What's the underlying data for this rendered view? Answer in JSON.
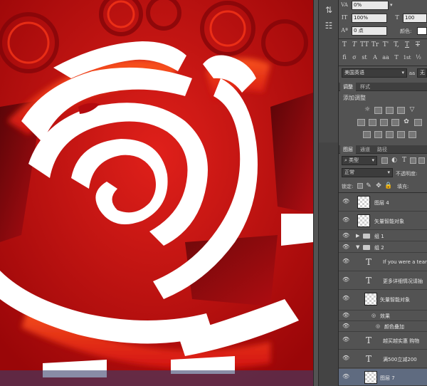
{
  "options": {
    "tracking_value": "0%",
    "vertical_scale_value": "100%",
    "horizontal_scale_value": "100",
    "baseline_value": "0 点",
    "color_label": "颜色:"
  },
  "character": {
    "style_glyphs": [
      "T",
      "T",
      "TT",
      "Tr",
      "T'",
      "T,",
      "T",
      "T"
    ],
    "ot_glyphs": [
      "fi",
      "σ",
      "st",
      "A",
      "aa",
      "T",
      "1st",
      "½"
    ],
    "language": "美国英语",
    "antialias": "无"
  },
  "adjustments": {
    "tabs": [
      "调整",
      "样式"
    ],
    "title": "添加调整"
  },
  "layers_panel": {
    "tabs": [
      "图层",
      "通道",
      "路径"
    ],
    "filter_label": "类型",
    "blend_mode": "正常",
    "opacity_label": "不透明度:",
    "lock_label": "锁定:",
    "fill_label": "填充:",
    "layers": [
      {
        "name": "图层 4",
        "kind": "pixel"
      },
      {
        "name": "矢量智能对象",
        "kind": "smart"
      },
      {
        "name": "组 1",
        "kind": "group"
      },
      {
        "name": "组 2",
        "kind": "group"
      },
      {
        "name": "If you were a tearc",
        "kind": "text"
      },
      {
        "name": "更多详细情况请抽",
        "kind": "text"
      },
      {
        "name": "矢量智能对象",
        "kind": "smart"
      },
      {
        "name": "效果",
        "kind": "effects"
      },
      {
        "name": "颜色叠加",
        "kind": "effect"
      },
      {
        "name": "越买越实惠 购物",
        "kind": "text"
      },
      {
        "name": "满500立减200",
        "kind": "text"
      },
      {
        "name": "图层 7",
        "kind": "pixel"
      }
    ]
  },
  "colors": {
    "canvas_red": "#c0080a",
    "panel_bg": "#535353",
    "selected_layer": "#5f6b80"
  }
}
